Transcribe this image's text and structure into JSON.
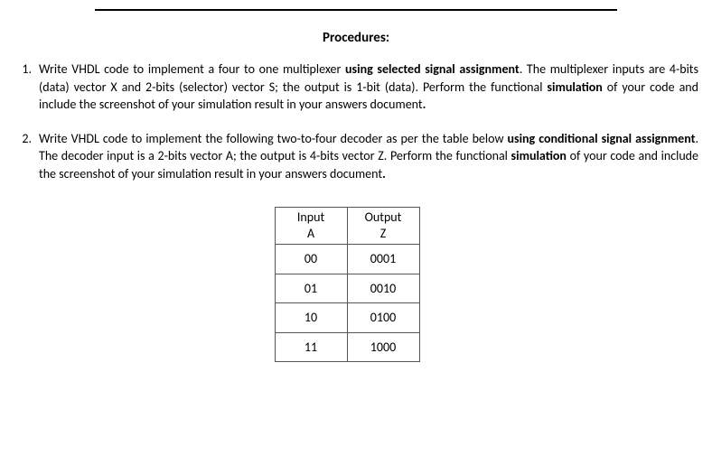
{
  "rule": "",
  "heading": "Procedures:",
  "items": [
    {
      "num": "1.",
      "seg1": "Write VHDL code to implement a four to one multiplexer ",
      "seg2_bold": "using selected signal assignment",
      "seg3": ". The multiplexer inputs are 4-bits (data) vector X and 2-bits (selector) vector S; the output is 1-bit (data). Perform the functional ",
      "seg4_bold": "simulation",
      "seg5": " of your code and include the screenshot of your simulation result in your answers document",
      "seg6_bold": "."
    },
    {
      "num": "2.",
      "seg1": "Write VHDL code to implement the following two-to-four decoder as per the table below ",
      "seg2_bold": "using conditional signal assignment",
      "seg3": ". The decoder input is a 2-bits vector A; the output is 4-bits vector Z. Perform the functional ",
      "seg4_bold": "simulation",
      "seg5": " of your code and include the screenshot of your simulation result in your answers document",
      "seg6_bold": "."
    }
  ],
  "chart_data": {
    "type": "table",
    "title": "",
    "columns": [
      {
        "header": "Input",
        "sub": "A"
      },
      {
        "header": "Output",
        "sub": "Z"
      }
    ],
    "rows": [
      {
        "a": "00",
        "z": "0001"
      },
      {
        "a": "01",
        "z": "0010"
      },
      {
        "a": "10",
        "z": "0100"
      },
      {
        "a": "11",
        "z": "1000"
      }
    ]
  }
}
